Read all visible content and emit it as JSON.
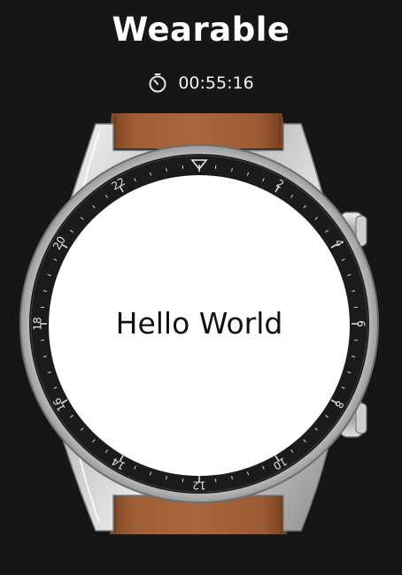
{
  "app": {
    "title": "Wearable"
  },
  "timer": {
    "icon": "timer-icon",
    "value": "00:55:16"
  },
  "device": {
    "screen_text": "Hello World",
    "bezel_numbers": [
      "2",
      "4",
      "6",
      "8",
      "10",
      "12",
      "14",
      "16",
      "18",
      "20",
      "22"
    ]
  },
  "colors": {
    "background": "#161616",
    "strap": "#9a5a33",
    "screen": "#ffffff",
    "bezel": "#1b1b1b"
  }
}
